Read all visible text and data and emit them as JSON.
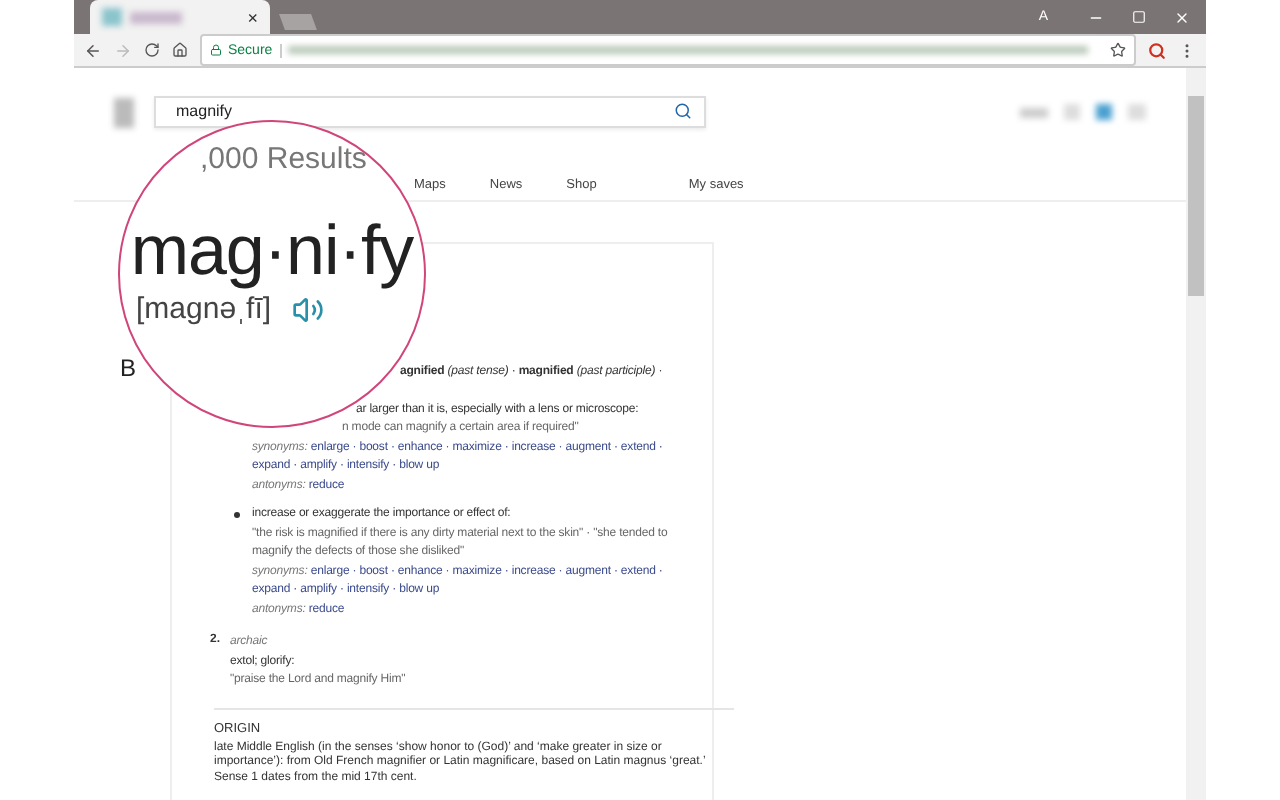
{
  "browser": {
    "tab_close": "×",
    "profile": "A",
    "secure_label": "Secure"
  },
  "search": {
    "value": "magnify"
  },
  "nav": {
    "results": ",000 Results",
    "links": [
      "Maps",
      "News",
      "Shop",
      "My saves"
    ]
  },
  "magnifier": {
    "word": "mag·ni·fy",
    "pronunciation": "[magnəˌfī]"
  },
  "margin_letter": "B",
  "definition": {
    "forms": "**agnified** *(past tense)* · **magnified** *(past participle)* ·",
    "sense_1": [
      {
        "bullet": false,
        "definition": "ar larger than it is, especially with a lens or microscope:",
        "example": "n mode can magnify a certain area if required\"",
        "synonyms_label": "synonyms:",
        "synonyms": "enlarge · boost · enhance · maximize · increase · augment · extend · expand · amplify · intensify · blow up",
        "antonyms_label": "antonyms:",
        "antonyms": "reduce"
      },
      {
        "bullet": true,
        "definition": "increase or exaggerate the importance or effect of:",
        "example": "\"the risk is magnified if there is any dirty material next to the skin\" · \"she tended to magnify the defects of those she disliked\"",
        "synonyms_label": "synonyms:",
        "synonyms": "enlarge · boost · enhance · maximize · increase · augment · extend · expand · amplify · intensify · blow up",
        "antonyms_label": "antonyms:",
        "antonyms": "reduce"
      }
    ],
    "sense_2": {
      "number": "2.",
      "register": "archaic",
      "definition": "extol; glorify:",
      "example": "\"praise the Lord and magnify Him\""
    },
    "origin": {
      "heading": "ORIGIN",
      "text": "late Middle English (in the senses ‘show honor to (God)’ and ‘make greater in size or importance’): from Old French magnifier or Latin magnificare, based on Latin magnus ‘great.’ Sense 1 dates from the mid 17th cent."
    }
  }
}
